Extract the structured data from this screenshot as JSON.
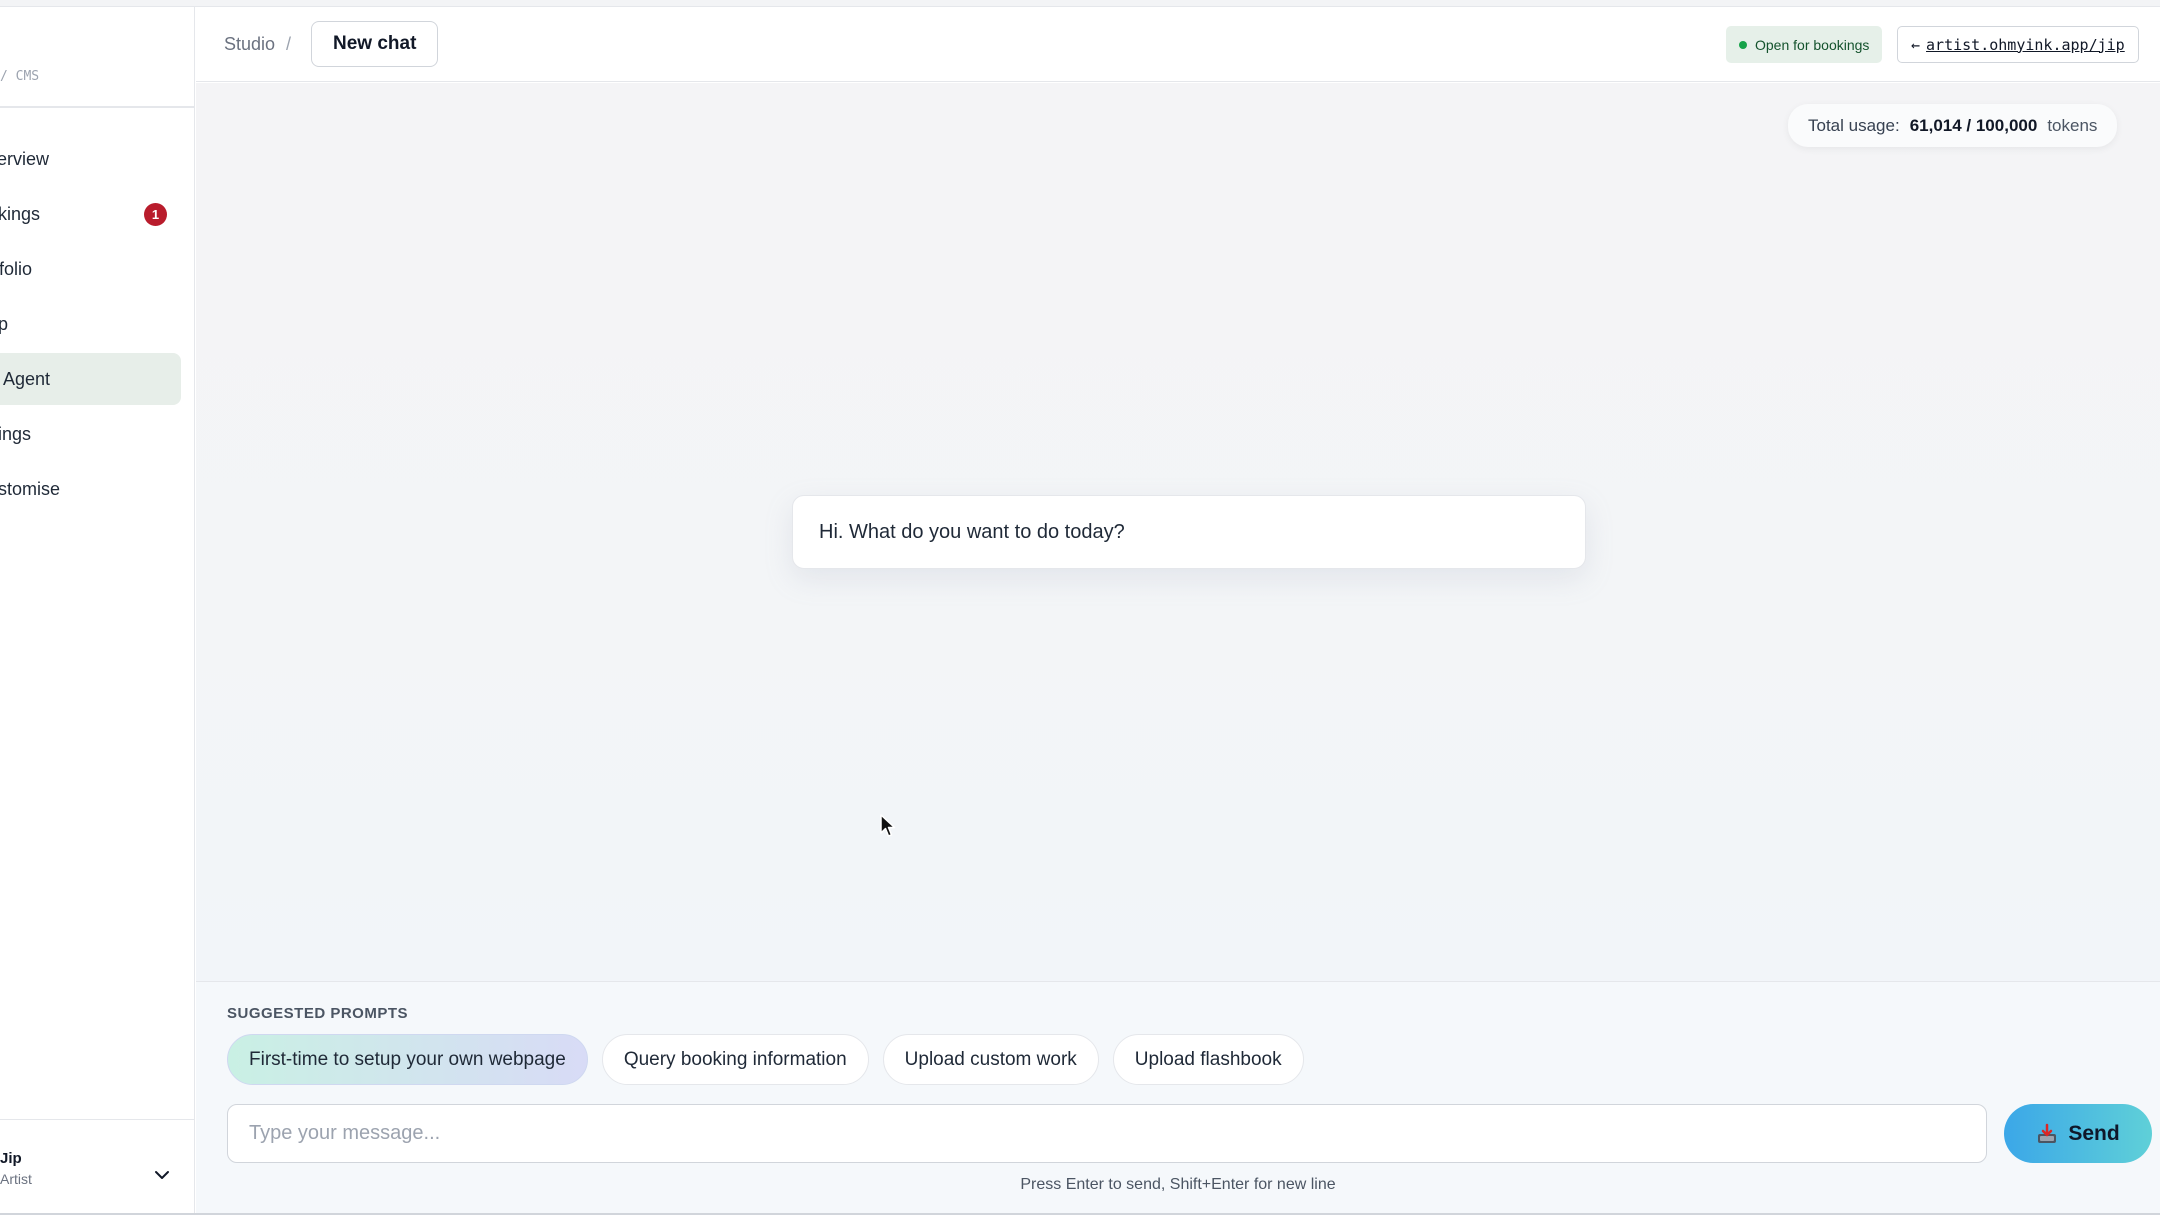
{
  "sidebar": {
    "brand": "/ CMS",
    "items": [
      {
        "label": "verview",
        "active": false
      },
      {
        "label": "okings",
        "active": false,
        "badge": "1"
      },
      {
        "label": "rtfolio",
        "active": false
      },
      {
        "label": "op",
        "active": false
      },
      {
        "label": "Agent",
        "active": true
      },
      {
        "label": "ttings",
        "active": false
      },
      {
        "label": "ustomise",
        "active": false
      }
    ],
    "user": {
      "name": "Jip",
      "role": "Artist"
    }
  },
  "header": {
    "breadcrumb": "Studio",
    "separator": "/",
    "chat_title": "New chat",
    "status": "Open for bookings",
    "link_arrow": "←",
    "link_url": "artist.ohmyink.app/jip"
  },
  "usage": {
    "label": "Total usage:",
    "value": "61,014 / 100,000",
    "unit": "tokens"
  },
  "greeting": "Hi. What do you want to do today?",
  "suggestions": {
    "title": "SUGGESTED PROMPTS",
    "chips": [
      "First-time to setup your own webpage",
      "Query booking information",
      "Upload custom work",
      "Upload flashbook"
    ]
  },
  "composer": {
    "placeholder": "Type your message...",
    "send_label": "Send",
    "hint": "Press Enter to send, Shift+Enter for new line"
  },
  "colors": {
    "accent_active_nav": "#e7eee9",
    "badge": "#b91c2c",
    "status_bg": "#e6f0e9",
    "send_gradient": [
      "#3ba7e8",
      "#5fd0d8"
    ]
  }
}
